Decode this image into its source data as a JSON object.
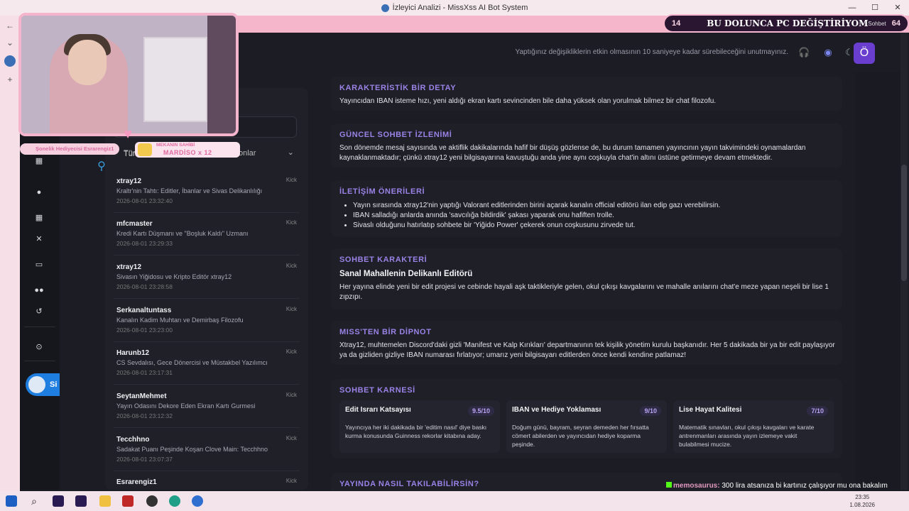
{
  "window": {
    "title": "İzleyici Analizi - MissXss AI Bot System",
    "controls": [
      "—",
      "☐",
      "✕"
    ]
  },
  "overlay": {
    "banner_left_num": "14",
    "banner_message": "BU DOLUNCA PC DEĞİŞTİRİYOM",
    "banner_tab": "Sohbet",
    "banner_right_num": "64",
    "badge_left": "Şonelik Hediyecisi Esrarengiz1",
    "badge_right_top": "MEKANIN SAHİBİ",
    "badge_right_name": "MARDİSO x 12",
    "chat_user": "memosaurus:",
    "chat_text": "300 lira atsanıza bi kartınız çalışıyor mu ona bakalım"
  },
  "header": {
    "notice": "Yaptığınız değişikliklerin etkin olmasının 10 saniyeye kadar sürebileceğini unutmayınız.",
    "avatar_letter": "Ö"
  },
  "rail": {
    "sis_label": "Si"
  },
  "panel": {
    "filter_prefix": "Tür",
    "filter_suffix": "onlar",
    "sessions": [
      {
        "name": "xtray12",
        "platform": "Kick",
        "title": "Kraltr'nin Tahtı: Editler, İbanlar ve Sivas Delikanlılığı",
        "date": "2026-08-01 23:32:40"
      },
      {
        "name": "mfcmaster",
        "platform": "Kick",
        "title": "Kredi Kartı Düşmanı ve \"Boşluk Kaldı\" Uzmanı",
        "date": "2026-08-01 23:29:33"
      },
      {
        "name": "xtray12",
        "platform": "Kick",
        "title": "Sivasın Yiğidosu ve Kripto Editör xtray12",
        "date": "2026-08-01 23:28:58"
      },
      {
        "name": "Serkanaltuntass",
        "platform": "Kick",
        "title": "Kanalın Kadim Muhtarı ve Demirbaş Filozofu",
        "date": "2026-08-01 23:23:00"
      },
      {
        "name": "Harunb12",
        "platform": "Kick",
        "title": "CS Sevdalısı, Gece Dönercisi ve Müstakbel Yazılımcı",
        "date": "2026-08-01 23:17:31"
      },
      {
        "name": "SeytanMehmet",
        "platform": "Kick",
        "title": "Yayın Odasını Dekore Eden Ekran Kartı Gurmesi",
        "date": "2026-08-01 23:12:32"
      },
      {
        "name": "Tecchhno",
        "platform": "Kick",
        "title": "Sadakat Puanı Peşinde Koşan Clove Main: Tecchhno",
        "date": "2026-08-01 23:07:37"
      },
      {
        "name": "Esrarengiz1",
        "platform": "Kick",
        "title": "",
        "date": ""
      }
    ]
  },
  "main": {
    "detail": {
      "heading": "KARAKTERİSTİK BİR DETAY",
      "text": "Yayıncıdan IBAN isteme hızı, yeni aldığı ekran kartı sevincinden bile daha yüksek olan yorulmak bilmez bir chat filozofu."
    },
    "watch": {
      "heading": "GÜNCEL SOHBET İZLENİMİ",
      "text": "Son dönemde mesaj sayısında ve aktiflik dakikalarında hafif bir düşüş gözlense de, bu durum tamamen yayıncının yayın takvimindeki oynamalardan kaynaklanmaktadır; çünkü xtray12 yeni bilgisayarına kavuştuğu anda yine aynı coşkuyla chat'in altını üstüne getirmeye devam etmektedir."
    },
    "tips": {
      "heading": "İLETİŞİM ÖNERİLERİ",
      "items": [
        "Yayın sırasında xtray12'nin yaptığı Valorant editlerinden birini açarak kanalın official editörü ilan edip gazı verebilirsin.",
        "IBAN salladığı anlarda anında 'savcılığa bildirdik' şakası yaparak onu hafiften trolle.",
        "Sivaslı olduğunu hatırlatıp sohbete bir 'Yiğido Power' çekerek onun coşkusunu zirvede tut."
      ]
    },
    "character": {
      "heading": "SOHBET KARAKTERİ",
      "subtitle": "Sanal Mahallenin Delikanlı Editörü",
      "text": "Her yayına elinde yeni bir edit projesi ve cebinde hayali aşk taktikleriyle gelen, okul çıkışı kavgalarını ve mahalle anılarını chat'e meze yapan neşeli bir lise 1 zıpzıpı."
    },
    "footnote": {
      "heading": "MISS'TEN BİR DİPNOT",
      "text": "Xtray12, muhtemelen Discord'daki gizli 'Manifest ve Kalp Kırıkları' departmanının tek kişilik yönetim kurulu başkanıdır. Her 5 dakikada bir ya bir edit paylaşıyor ya da gizliden gizliye IBAN numarası fırlatıyor; umarız yeni bilgisayarı editlerden önce kendi kendine patlamaz!"
    },
    "report": {
      "heading": "SOHBET KARNESİ",
      "scores": [
        {
          "title": "Edit Israrı Katsayısı",
          "value": "9.5/10",
          "desc": "Yayıncıya her iki dakikada bir 'editim nasıl' diye baskı kurma konusunda Guinness rekorlar kitabına aday."
        },
        {
          "title": "IBAN ve Hediye Yoklaması",
          "value": "9/10",
          "desc": "Doğum günü, bayram, seyran demeden her fırsatta cömert abilerden ve yayıncıdan hediye koparma peşinde."
        },
        {
          "title": "Lise Hayat Kalitesi",
          "value": "7/10",
          "desc": "Matematik sınavları, okul çıkışı kavgaları ve karate antrenmanları arasında yayın izlemeye vakit bulabilmesi mucize."
        }
      ]
    },
    "join": {
      "heading": "YAYINDA NASIL TAKILABİLİRSİN?"
    }
  },
  "taskbar": {
    "time": "23:35",
    "date": "1.08.2026"
  }
}
